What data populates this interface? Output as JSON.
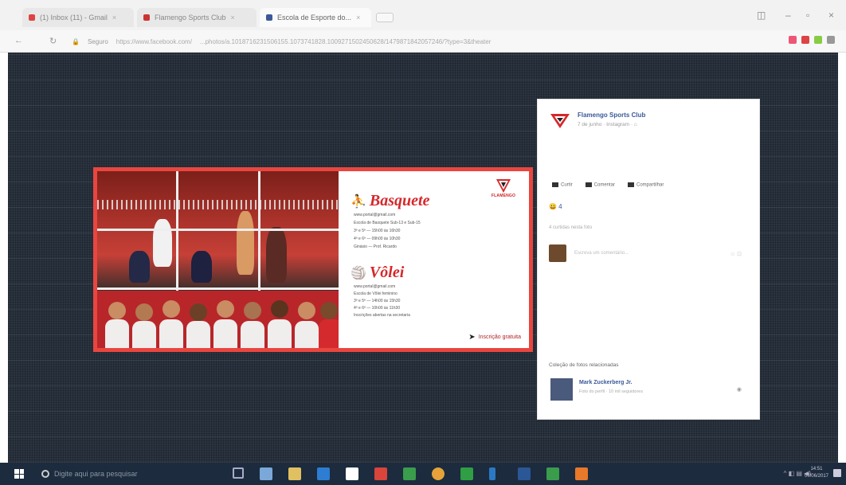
{
  "browser": {
    "tabs": [
      {
        "label": "(1) Inbox (11) - Gmail"
      },
      {
        "label": "Flamengo Sports Club"
      },
      {
        "label": "Escola de Esporte do..."
      }
    ],
    "address_host": "Seguro",
    "address_url": "https://www.facebook.com/",
    "address_path": "...photos/a.1018716231506155.1073741828.1009271502450628/1479871842057246/?type=3&theater"
  },
  "flyer": {
    "logo_label": "FLAMENGO",
    "basquete": {
      "title": "Basquete",
      "lines": [
        "www.portal@gmail.com",
        "Escola de Basquete Sub-13 e Sub-15",
        "3ª e 5ª — 15h00 às 16h30",
        "4ª e 6ª — 09h00 às 10h30",
        "Ginásio — Prof. Ricardo"
      ]
    },
    "volei": {
      "title": "Vôlei",
      "lines": [
        "www.portal@gmail.com",
        "Escola de Vôlei feminino",
        "3ª e 5ª — 14h00 às 15h30",
        "4ª e 6ª — 10h00 às 11h30",
        "Inscrições abertas na secretaria"
      ]
    },
    "cta": "Inscrição gratuita"
  },
  "facebook": {
    "page_name": "Flamengo Sports Club",
    "subtitle": "7 de junho · Instagram · ⌂",
    "actions": [
      "Curtir",
      "Comentar",
      "Compartilhar"
    ],
    "reactions": "😀 4",
    "reaction_count": "4 curtidas nesta foto",
    "comment_placeholder": "Escreva um comentário...",
    "comment_emoji": "☺ ⊡",
    "related_label": "Coleção de fotos relacionadas",
    "related_name": "Mark Zuckerberg Jr.",
    "related_sub": "Foto do perfil · 10 mil seguidores",
    "related_action": "◉"
  },
  "taskbar": {
    "search_placeholder": "Digite aqui para pesquisar",
    "tray": "^ ◧ ▤ ◀)",
    "time": "14:51",
    "date": "07/06/2017"
  },
  "colors": {
    "page_bg": "#2b3441",
    "flyer_red": "#e8463f",
    "fb_blue": "#3b5998",
    "taskbar": "#1c2b3d"
  }
}
